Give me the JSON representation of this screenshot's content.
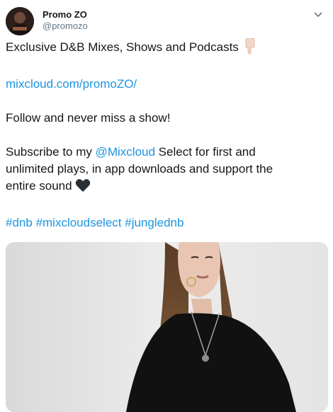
{
  "tweet": {
    "display_name": "Promo ZO",
    "handle": "@promozo",
    "line1_text": "Exclusive D&B Mixes, Shows and Podcasts",
    "line1_emoji": "pointing-down-emoji",
    "link_url": "mixcloud.com/promoZO/",
    "line3": "Follow and never miss a show!",
    "line4_prefix": "Subscribe to my ",
    "line4_mention": "@Mixcloud",
    "line4_suffix": " Select for first and",
    "line5": "unlimited plays, in app downloads and support the",
    "line6_text": "entire sound",
    "line6_emoji": "black-heart-emoji",
    "hashtags": [
      "#dnb",
      "#mixcloudselect",
      "#junglednb"
    ]
  },
  "colors": {
    "link": "#1b95e0",
    "text": "#14171a",
    "muted": "#657786"
  },
  "media": {
    "icon": "photo-woman-black-tshirt"
  }
}
